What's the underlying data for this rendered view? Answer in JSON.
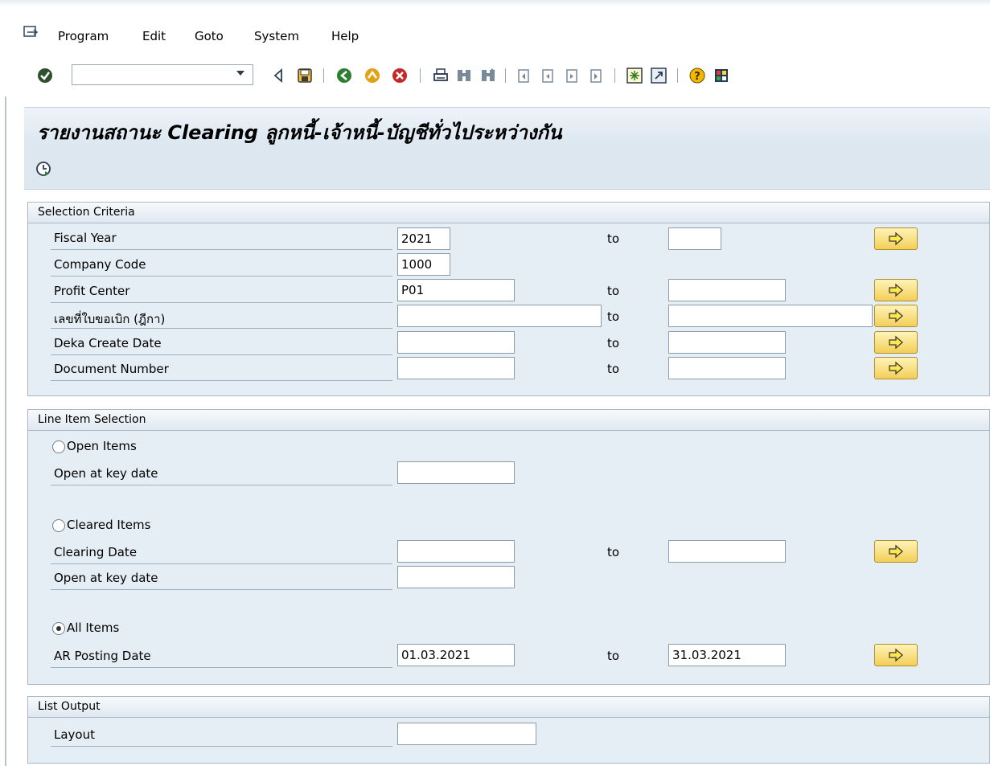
{
  "menu": {
    "items": [
      {
        "label": "Program"
      },
      {
        "label": "Edit"
      },
      {
        "label": "Goto"
      },
      {
        "label": "System"
      },
      {
        "label": "Help"
      }
    ]
  },
  "toolbar": {
    "command_value": "",
    "icons": [
      "enter-check-icon",
      "back-triangle-icon",
      "save-icon",
      "back-icon",
      "exit-icon",
      "cancel-icon",
      "print-icon",
      "find-icon",
      "find-next-icon",
      "first-page-icon",
      "previous-page-icon",
      "next-page-icon",
      "last-page-icon",
      "create-session-icon",
      "shortcut-icon",
      "help-icon",
      "customize-layout-icon"
    ]
  },
  "title": "รายงานสถานะ Clearing ลูกหนี้-เจ้าหนี้-บัญชีทั่วไประหว่างกัน",
  "appbar": {
    "execute_icon": "execute-clock-icon"
  },
  "selection_criteria": {
    "title": "Selection Criteria",
    "to_label": "to",
    "rows": [
      {
        "label": "Fiscal Year",
        "from": "2021",
        "to": ""
      },
      {
        "label": "Company Code",
        "from": "1000"
      },
      {
        "label": "Profit Center",
        "from": "P01",
        "to": ""
      },
      {
        "label": "เลขที่ใบขอเบิก (ฎีกา)",
        "from": "",
        "to": ""
      },
      {
        "label": "Deka Create Date",
        "from": "",
        "to": ""
      },
      {
        "label": "Document Number",
        "from": "",
        "to": ""
      }
    ]
  },
  "line_item_selection": {
    "title": "Line Item Selection",
    "open_items": {
      "label": "Open Items",
      "selected": false,
      "key_date_label": "Open at key date",
      "key_date": ""
    },
    "cleared_items": {
      "label": "Cleared Items",
      "selected": false,
      "clearing_date_label": "Clearing Date",
      "clearing_from": "",
      "clearing_to": "",
      "key_date_label": "Open at key date",
      "key_date": ""
    },
    "all_items": {
      "label": "All Items",
      "selected": true,
      "posting_label": "AR Posting Date",
      "posting_from": "01.03.2021",
      "posting_to": "31.03.2021"
    }
  },
  "list_output": {
    "title": "List Output",
    "layout_label": "Layout",
    "layout_value": ""
  },
  "colors": {
    "accent_button": "#f3cf57",
    "group_bg": "#e6eef5",
    "title_bg": "#dbe6f0"
  }
}
